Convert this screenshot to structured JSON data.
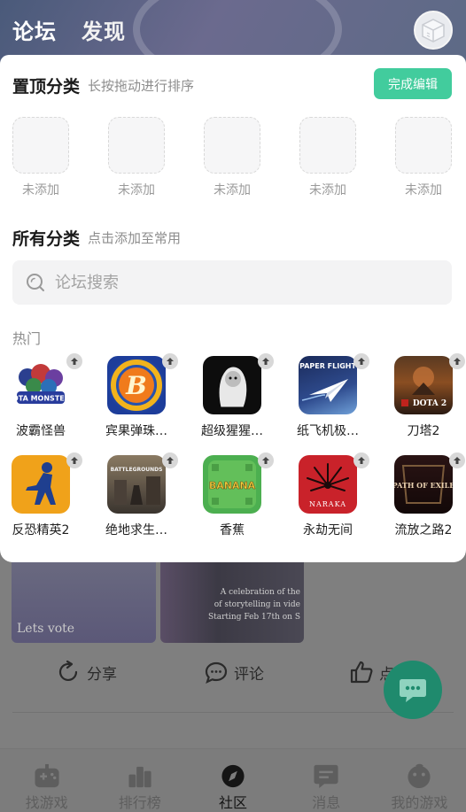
{
  "top_tabs": [
    {
      "label": "论坛",
      "active": true
    },
    {
      "label": "发现",
      "active": false
    }
  ],
  "panel": {
    "pinned_title": "置顶分类",
    "pinned_hint": "长按拖动进行排序",
    "done_button": "完成编辑",
    "pinned_slots": [
      "未添加",
      "未添加",
      "未添加",
      "未添加",
      "未添加"
    ],
    "all_title": "所有分类",
    "all_hint": "点击添加至常用",
    "search_placeholder": "论坛搜索",
    "hot_label": "热门",
    "games": [
      {
        "name": "波霸怪兽",
        "icon": "dota-monsters-icon",
        "art_text": "DOTA MONSTERS"
      },
      {
        "name": "宾果弹珠…",
        "icon": "bingo-pinball-icon",
        "art_text": "B"
      },
      {
        "name": "超级猩猩…",
        "icon": "super-gorilla-icon",
        "art_text": ""
      },
      {
        "name": "纸飞机极…",
        "icon": "paper-flight-icon",
        "art_text": "PAPER FLIGHT"
      },
      {
        "name": "刀塔2",
        "icon": "dota2-icon",
        "art_text": "DOTA 2"
      },
      {
        "name": "反恐精英2",
        "icon": "counter-strike-icon",
        "art_text": ""
      },
      {
        "name": "绝地求生…",
        "icon": "pubg-icon",
        "art_text": "BATTLEGROUNDS"
      },
      {
        "name": "香蕉",
        "icon": "banana-icon",
        "art_text": "BANANA"
      },
      {
        "name": "永劫无间",
        "icon": "naraka-icon",
        "art_text": "NARAKA"
      },
      {
        "name": "流放之路2",
        "icon": "path-of-exile-icon",
        "art_text": "PATH OF EXILE"
      }
    ]
  },
  "background_feed": {
    "image_caption_lines": [
      "A celebration of the",
      "of storytelling in vide",
      "Starting Feb 17th on S"
    ],
    "image_scribble": "Lets vote",
    "actions": [
      {
        "label": "分享",
        "icon": "share-icon"
      },
      {
        "label": "评论",
        "icon": "comment-icon"
      },
      {
        "label": "点",
        "icon": "like-icon"
      }
    ]
  },
  "bottom_nav": [
    {
      "label": "找游戏",
      "icon": "gamepad-icon",
      "active": false
    },
    {
      "label": "排行榜",
      "icon": "ranking-icon",
      "active": false
    },
    {
      "label": "社区",
      "icon": "compass-icon",
      "active": true
    },
    {
      "label": "消息",
      "icon": "message-icon",
      "active": false
    },
    {
      "label": "我的游戏",
      "icon": "my-games-icon",
      "active": false
    }
  ],
  "colors": {
    "accent": "#42cc9d",
    "fab": "#1f8a6d",
    "overlay_dim": "#7e7e7e"
  }
}
